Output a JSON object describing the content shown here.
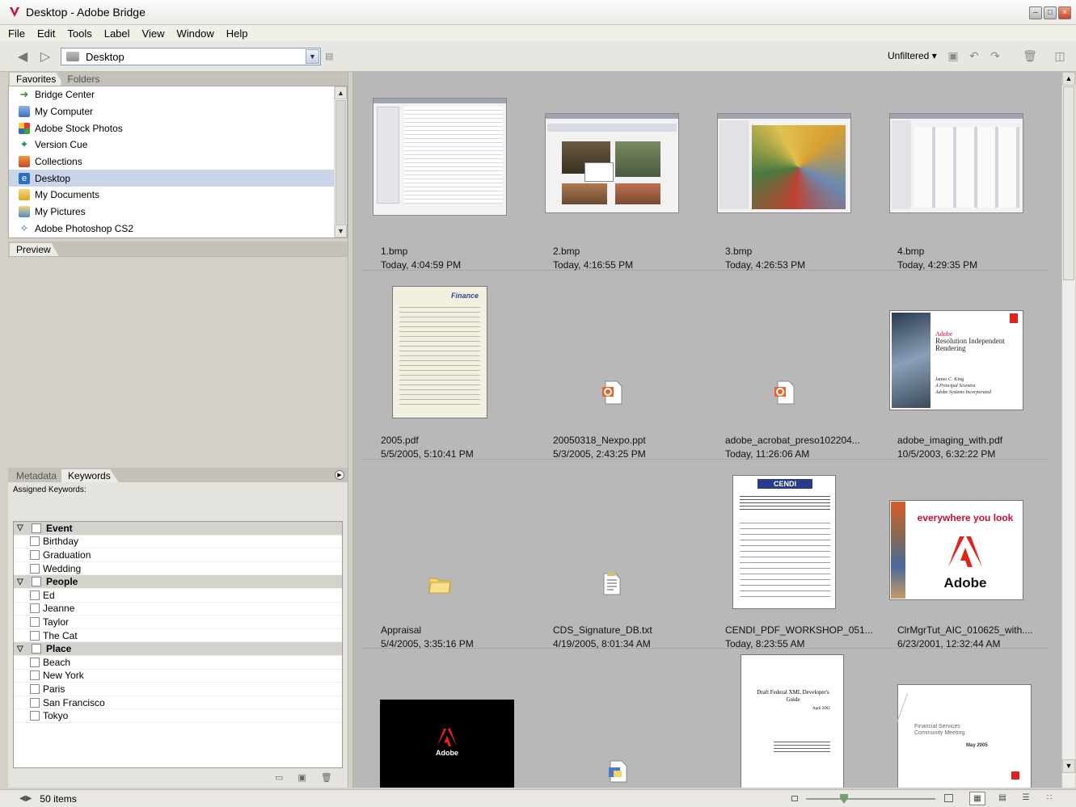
{
  "window": {
    "title": "Desktop - Adobe Bridge"
  },
  "menu": [
    "File",
    "Edit",
    "Tools",
    "Label",
    "View",
    "Window",
    "Help"
  ],
  "toolbar": {
    "path": "Desktop",
    "filter_label": "Unfiltered"
  },
  "left_tabs": {
    "favorites": "Favorites",
    "folders": "Folders"
  },
  "favorites": [
    {
      "label": "Bridge Center",
      "icon": "bridge-center-icon"
    },
    {
      "label": "My Computer",
      "icon": "computer-icon"
    },
    {
      "label": "Adobe Stock Photos",
      "icon": "stock-photos-icon"
    },
    {
      "label": "Version Cue",
      "icon": "version-cue-icon"
    },
    {
      "label": "Collections",
      "icon": "collections-icon"
    },
    {
      "label": "Desktop",
      "icon": "desktop-icon",
      "selected": true
    },
    {
      "label": "My Documents",
      "icon": "documents-icon"
    },
    {
      "label": "My Pictures",
      "icon": "pictures-icon"
    },
    {
      "label": "Adobe Photoshop CS2",
      "icon": "photoshop-icon"
    }
  ],
  "preview_tab": "Preview",
  "meta_tabs": {
    "metadata": "Metadata",
    "keywords": "Keywords"
  },
  "assigned_keywords_label": "Assigned Keywords:",
  "keywords": [
    {
      "label": "Event",
      "category": true
    },
    {
      "label": "Birthday"
    },
    {
      "label": "Graduation"
    },
    {
      "label": "Wedding"
    },
    {
      "label": "People",
      "category": true
    },
    {
      "label": "Ed"
    },
    {
      "label": "Jeanne"
    },
    {
      "label": "Taylor"
    },
    {
      "label": "The Cat"
    },
    {
      "label": "Place",
      "category": true
    },
    {
      "label": "Beach"
    },
    {
      "label": "New York"
    },
    {
      "label": "Paris"
    },
    {
      "label": "San Francisco"
    },
    {
      "label": "Tokyo"
    }
  ],
  "files": [
    {
      "name": "1.bmp",
      "date": "Today, 4:04:59 PM"
    },
    {
      "name": "2.bmp",
      "date": "Today, 4:16:55 PM"
    },
    {
      "name": "3.bmp",
      "date": "Today, 4:26:53 PM"
    },
    {
      "name": "4.bmp",
      "date": "Today, 4:29:35 PM"
    },
    {
      "name": "2005.pdf",
      "date": "5/5/2005, 5:10:41 PM"
    },
    {
      "name": "20050318_Nexpo.ppt",
      "date": "5/3/2005, 2:43:25 PM"
    },
    {
      "name": "adobe_acrobat_preso102204...",
      "date": "Today, 11:26:06 AM"
    },
    {
      "name": "adobe_imaging_with.pdf",
      "date": "10/5/2003, 6:32:22 PM"
    },
    {
      "name": "Appraisal",
      "date": "5/4/2005, 3:35:16 PM"
    },
    {
      "name": "CDS_Signature_DB.txt",
      "date": "4/19/2005, 8:01:34 AM"
    },
    {
      "name": "CENDI_PDF_WORKSHOP_051...",
      "date": "Today, 8:23:55 AM"
    },
    {
      "name": "ClrMgrTut_AIC_010625_with....",
      "date": "6/23/2001, 12:32:44 AM"
    }
  ],
  "thumb_text": {
    "finance": "Finance",
    "adobe_pdf_title": "Adobe",
    "adobe_pdf_sub": "Resolution Independent Rendering",
    "adobe_pdf_author": "James C. King",
    "adobe_pdf_role": "A Principal Scientist",
    "adobe_pdf_org": "Adobe Systems Incorporated",
    "cendi_head": "CENDI",
    "everywhere": "everywhere you look",
    "adobe_word": "Adobe",
    "xml_title": "Draft Federal XML Developer's Guide",
    "xml_date": "April 2002",
    "fin_services": "Financial Services Community Meeting",
    "fin_date": "May 2005"
  },
  "status": {
    "count": "50 items"
  },
  "colors": {
    "content_bg": "#b8b8b8",
    "selection": "#c9d6ea",
    "adobe_red": "#e0231b"
  }
}
